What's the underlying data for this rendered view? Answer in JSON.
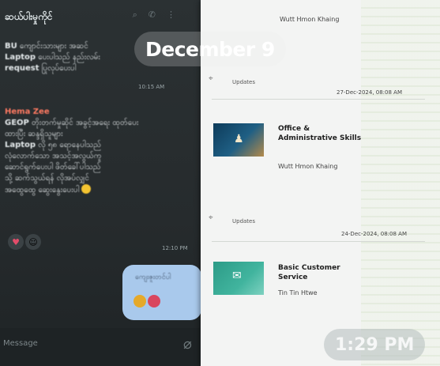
{
  "chat": {
    "title": "ဆယ်ပါးမှုကိုင်",
    "header_icons": [
      "search-icon",
      "phone-icon",
      "menu-icon"
    ],
    "message1": {
      "line1_bold": "BU",
      "line1": " ကျောင်းသားများ အဆင်",
      "line2_bold": "Laptop",
      "line2": " ပေးပါသည် နည်းလမ်း",
      "line3_bold": "request",
      "line3": " ပြုလုပ်ပေးပါ",
      "time": "10:15 AM"
    },
    "message2": {
      "sender": "Hema Zee",
      "line1_bold": "GEOP",
      "line1": " တိုးတက်မှုဆိုင် အခွင့်အရေး ထုတ်ပေး",
      "line2": "ထားပြီး ဆန္ဒရှိသူများ",
      "line3_bold": "Laptop",
      "line3": " လို ၅၈ ရောနေပါသည်",
      "line4": "လုံလောက်သော အသင့်အလွယ်ကူ",
      "line5": "ဆောင်ရွက်ပေးပါ ဖိတ်ခေါ်ပါသည်",
      "line6": "သို့ ဆက်သွယ်ရန် လိုအပ်လျှင်",
      "line7": "အထွေထွေ ဆွေးနွေးပေးပါ",
      "time": "12:10 PM",
      "reactions": [
        "heart",
        "avatar"
      ]
    },
    "outgoing_bubble": {
      "text": "ကျေးဇူးတင်ပါ",
      "reactions": [
        "flower",
        "avatar"
      ]
    },
    "composer_placeholder": "Message"
  },
  "date_overlay": "December 9",
  "time_overlay": "1:29 PM",
  "documents": {
    "top_author": "Wutt Hmon Khaing",
    "items": [
      {
        "update_label": "Updates",
        "timestamp": "27-Dec-2024, 08:08 AM",
        "title": "Office & Administrative Skills",
        "author": "Wutt Hmon Khaing"
      },
      {
        "update_label": "Updates",
        "timestamp": "24-Dec-2024, 08:08 AM",
        "title": "Basic Customer Service",
        "author": "Tin Tin Htwe"
      }
    ]
  },
  "colors": {
    "chat_bg": "#262b2d",
    "accent_sender": "#ff7a62",
    "bubble_out": "#a9c9ec",
    "doc_bg": "#f3f4f3"
  }
}
